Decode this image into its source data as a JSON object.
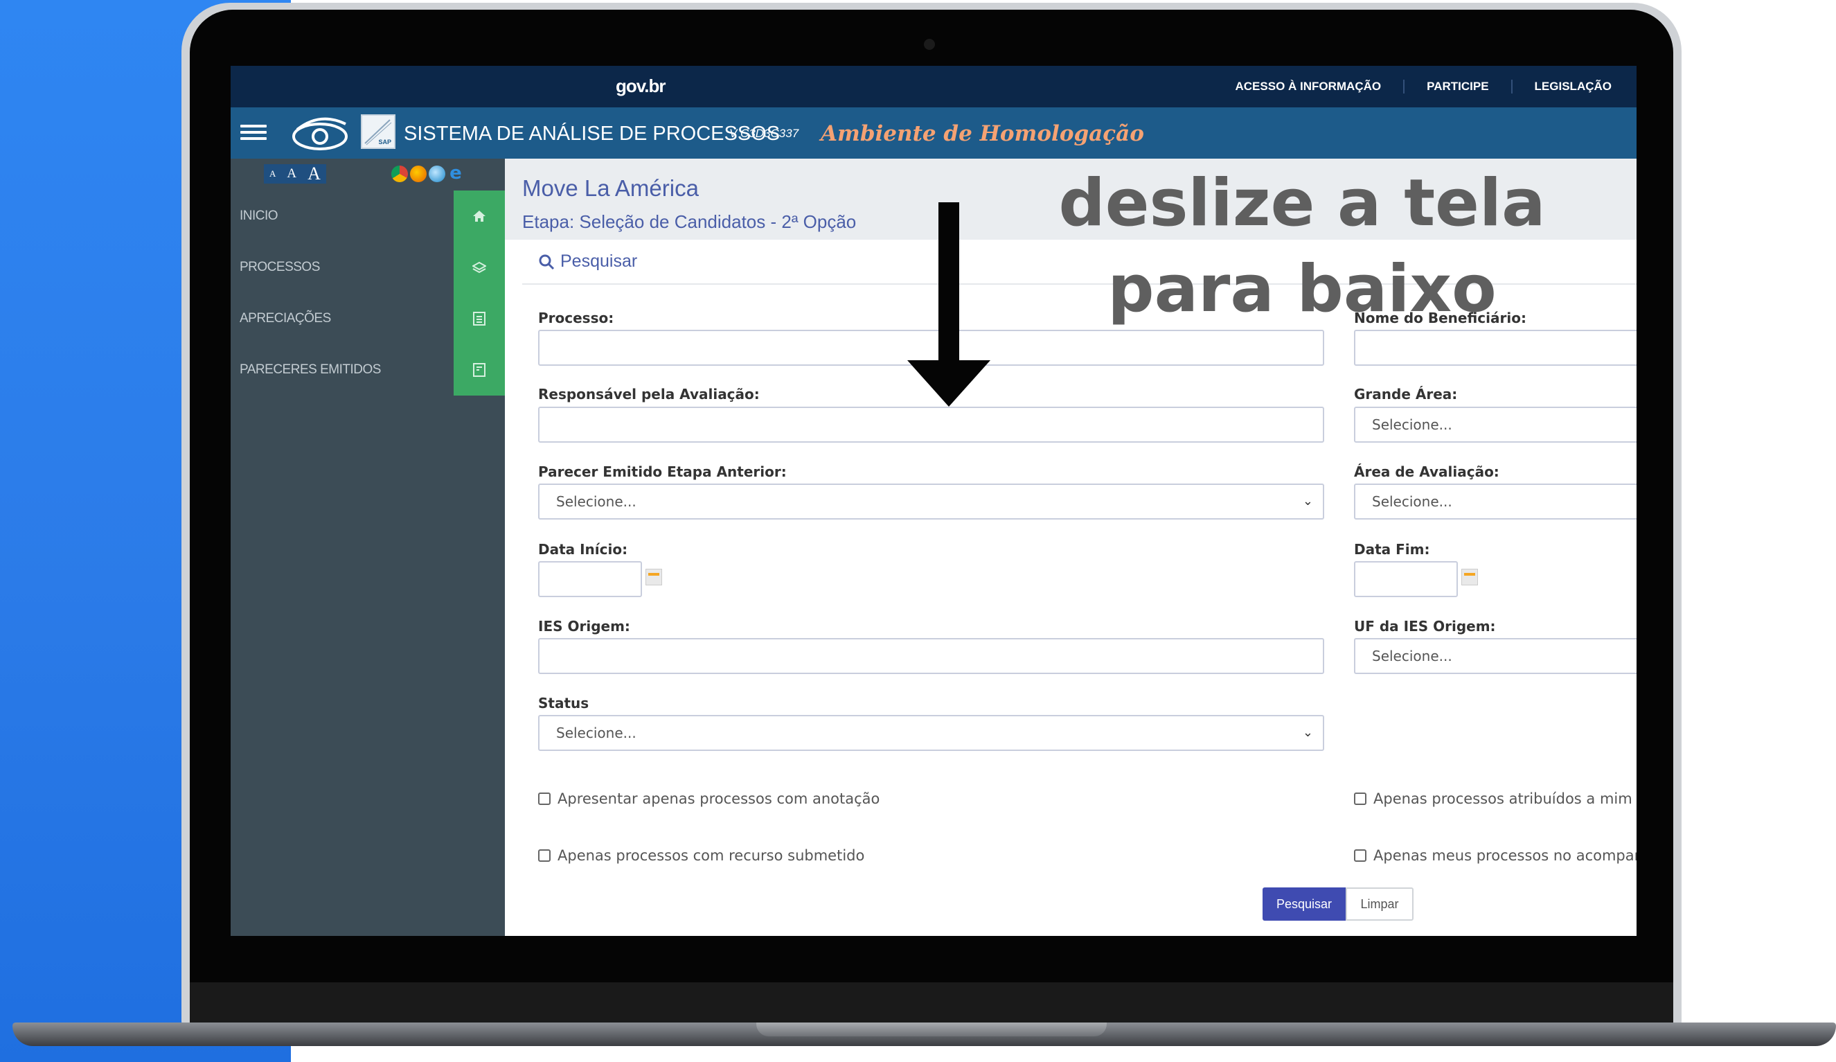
{
  "gov_bar": {
    "logo": "gov.br",
    "links": [
      "ACESSO À INFORMAÇÃO",
      "PARTICIPE",
      "LEGISLAÇÃO"
    ]
  },
  "app_bar": {
    "title": "SISTEMA DE ANÁLISE DE PROCESSOS",
    "version": "V C3D3C337",
    "environment": "Ambiente de Homologação",
    "logo_text": "SAP"
  },
  "accessibility": {
    "font_sizes": [
      "A",
      "A",
      "A"
    ]
  },
  "sidebar": {
    "items": [
      {
        "label": "INICIO",
        "icon": "home-icon"
      },
      {
        "label": "PROCESSOS",
        "icon": "layers-icon"
      },
      {
        "label": "APRECIAÇÕES",
        "icon": "list-icon"
      },
      {
        "label": "PARECERES EMITIDOS",
        "icon": "document-icon"
      }
    ]
  },
  "main": {
    "title": "Move La América",
    "subtitle": "Etapa: Seleção de Candidatos - 2ª Opção",
    "search_tab": "Pesquisar",
    "fields": {
      "processo": {
        "label": "Processo:",
        "value": ""
      },
      "nome_beneficiario": {
        "label": "Nome do Beneficiário:",
        "value": ""
      },
      "responsavel": {
        "label": "Responsável pela Avaliação:",
        "value": ""
      },
      "grande_area": {
        "label": "Grande Área:",
        "value": "Selecione..."
      },
      "parecer": {
        "label": "Parecer Emitido Etapa Anterior:",
        "value": "Selecione..."
      },
      "area_avaliacao": {
        "label": "Área de Avaliação:",
        "value": "Selecione..."
      },
      "data_inicio": {
        "label": "Data Início:",
        "value": ""
      },
      "data_fim": {
        "label": "Data Fim:",
        "value": ""
      },
      "ies_origem": {
        "label": "IES Origem:",
        "value": ""
      },
      "uf_ies": {
        "label": "UF da IES Origem:",
        "value": "Selecione..."
      },
      "status": {
        "label": "Status",
        "value": "Selecione..."
      }
    },
    "checkboxes": {
      "anotacao": "Apresentar apenas processos com anotação",
      "atribuidos": "Apenas processos atribuídos a mim",
      "recurso": "Apenas processos com recurso submetido",
      "acompanhamento": "Apenas meus processos no acompanha"
    },
    "buttons": {
      "search": "Pesquisar",
      "clear": "Limpar"
    }
  },
  "overlay": {
    "text": "deslize a tela para baixo"
  },
  "colors": {
    "gov_bar": "#0c2749",
    "app_bar": "#1d5b8a",
    "sidebar": "#3c4c56",
    "sidebar_icon_cell": "#3ca964",
    "accent": "#4a5ea8",
    "primary_button": "#3f4bb1",
    "environment": "#f5a273"
  }
}
